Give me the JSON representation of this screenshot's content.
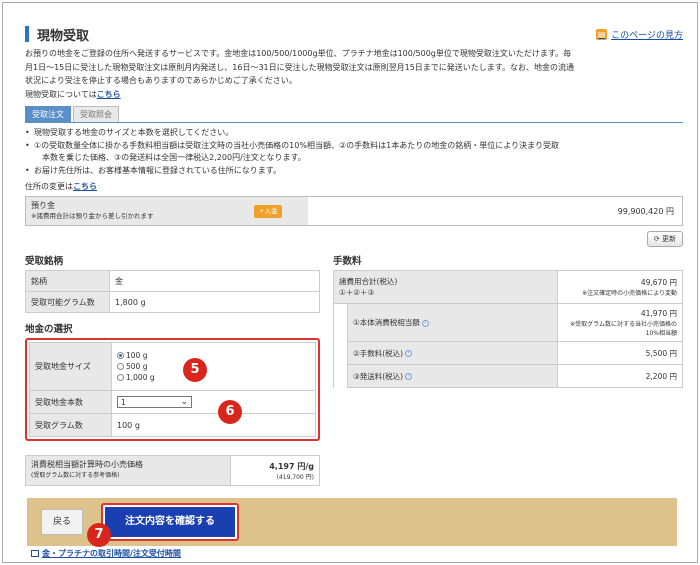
{
  "page": {
    "title": "現物受取",
    "help_link": "このページの見方",
    "intro_lines": [
      "お預りの地金をご登録の住所へ発送するサービスです。金地金は100/500/1000g単位、プラチナ地金は100/500g単位で現物受取注文いただけます。毎",
      "月1日〜15日に受注した現物受取注文は原則月内発送し、16日〜31日に受注した現物受取注文は原則翌月15日までに発送いたします。なお、地金の流通",
      "状況により受注を停止する場合もありますのであらかじめご了承ください。"
    ],
    "about_prefix": "現物受取については",
    "about_link": "こちら"
  },
  "tabs": [
    {
      "label": "受取注文"
    },
    {
      "label": "受取照会"
    }
  ],
  "notes": [
    "現物受取する地金のサイズと本数を選択してください。",
    "①の受取数量全体に掛かる手数料相当額は受取注文時の当社小売価格の10%相当額、②の手数料は1本あたりの地金の銘柄・単位により決まり受取",
    "本数を乗じた価格、③の発送料は全国一律税込2,200円/注文となります。",
    "お届け先住所は、お客様基本情報に登録されている住所になります。"
  ],
  "address": {
    "prefix": "住所の変更は",
    "link": "こちら"
  },
  "deposit": {
    "label": "預り金",
    "sub": "※諸費用合計は預り金から差し引かれます",
    "deposit_button": "+入金",
    "value": "99,900,420 円"
  },
  "refresh_label": "⟳ 更新",
  "brand_section": {
    "heading": "受取銘柄",
    "rows": [
      {
        "label": "銘柄",
        "value": "金"
      },
      {
        "label": "受取可能グラム数",
        "value": "1,800 g"
      }
    ]
  },
  "gold_section": {
    "heading": "地金の選択",
    "size_label": "受取地金サイズ",
    "sizes": [
      "100 g",
      "500 g",
      "1,000 g"
    ],
    "count_label": "受取地金本数",
    "count_value": "1",
    "grams_label": "受取グラム数",
    "grams_value": "100 g"
  },
  "fee_section": {
    "heading": "手数料",
    "total_label": "諸費用合計(税込)",
    "total_formula": "①＋②＋③",
    "total_value": "49,670 円",
    "total_note": "※注文確定時の小売価格により変動",
    "item1_label": "①本体消費税相当額",
    "item1_value": "41,970 円",
    "item1_note": "※受取グラム数に対する当社小売価格の10%相当額",
    "item2_label": "②手数料(税込)",
    "item2_value": "5,500 円",
    "item3_label": "③発送料(税込)",
    "item3_value": "2,200 円"
  },
  "price_section": {
    "label": "消費税相当額計算時の小売価格",
    "sub": "(受取グラム数に対する参考価格)",
    "value": "4,197 円/g",
    "sub_value": "(419,700 円)"
  },
  "footer": {
    "back_label": "戻る",
    "confirm_label": "注文内容を確認する"
  },
  "bottom_link": "金・プラチナの取引時間/注文受付時間",
  "badges": [
    "5",
    "6",
    "7"
  ],
  "colors": {
    "accent": "#2b73c9",
    "badge": "#d9261c",
    "footer_bg": "#ddc28c",
    "confirm_bg": "#1a3fb0"
  }
}
